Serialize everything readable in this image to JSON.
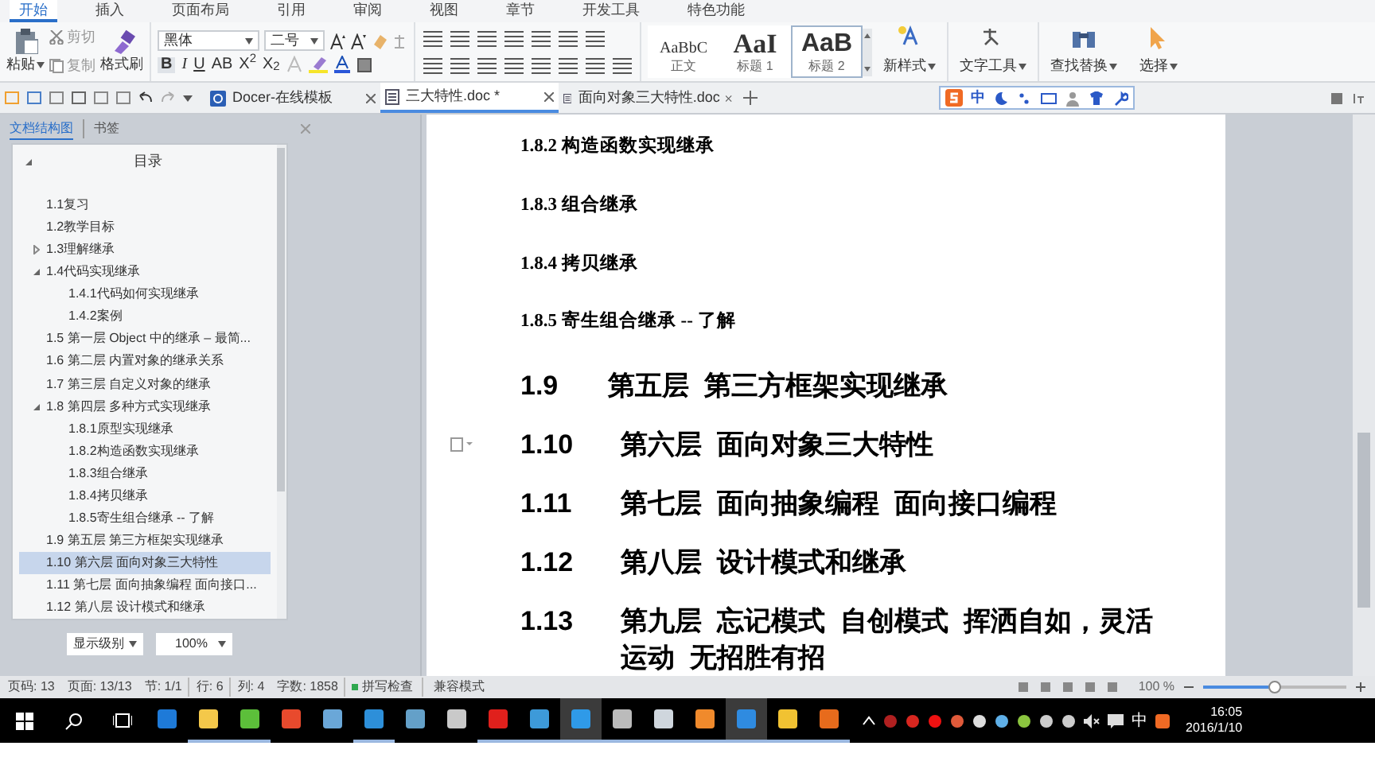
{
  "menu_tabs": [
    {
      "label": "开始",
      "selected": true
    },
    {
      "label": "插入",
      "selected": false
    },
    {
      "label": "页面布局",
      "selected": false
    },
    {
      "label": "引用",
      "selected": false
    },
    {
      "label": "审阅",
      "selected": false
    },
    {
      "label": "视图",
      "selected": false
    },
    {
      "label": "章节",
      "selected": false
    },
    {
      "label": "开发工具",
      "selected": false
    },
    {
      "label": "特色功能",
      "selected": false
    }
  ],
  "ribbon": {
    "paste": "粘贴",
    "cut": "剪切",
    "copy": "复制",
    "format_painter": "格式刷",
    "font_name": "黑体",
    "font_size": "二号",
    "format_buttons": [
      "B",
      "I",
      "U",
      "AB",
      "X$^{2}$",
      "X$_{2}$"
    ],
    "styles": [
      {
        "preview": "AaBbC",
        "label": "正文",
        "selected": false
      },
      {
        "preview": "AaI",
        "label": "标题 1",
        "selected": false
      },
      {
        "preview": "AaB",
        "label": "标题 2",
        "selected": true
      }
    ],
    "tools": [
      "新样式",
      "文字工具",
      "查找替换",
      "选择"
    ]
  },
  "doc_tabs": [
    {
      "label": "Docer-在线模板",
      "selected": false
    },
    {
      "label": "三大特性.doc *",
      "selected": true
    },
    {
      "label": "面向对象三大特性.doc",
      "selected": false
    }
  ],
  "ime_bar": {
    "mode": "中"
  },
  "navigation": {
    "tabs": [
      {
        "label": "文档结构图",
        "selected": true
      },
      {
        "label": "书签",
        "selected": false
      }
    ],
    "title": "目录",
    "items": [
      {
        "label": "1.1复习",
        "selected": false
      },
      {
        "label": "1.2教学目标",
        "selected": false
      },
      {
        "label": "1.3理解继承",
        "selected": false,
        "expanded": false
      },
      {
        "label": "1.4代码实现继承",
        "selected": false,
        "expanded": true,
        "children": [
          {
            "label": "1.4.1代码如何实现继承",
            "selected": false
          },
          {
            "label": "1.4.2案例",
            "selected": false
          }
        ]
      },
      {
        "label": "1.5 第一层 Object 中的继承 – 最简...",
        "selected": false
      },
      {
        "label": "1.6 第二层 内置对象的继承关系",
        "selected": false
      },
      {
        "label": "1.7 第三层 自定义对象的继承",
        "selected": false
      },
      {
        "label": "1.8 第四层 多种方式实现继承",
        "selected": false,
        "expanded": true,
        "children": [
          {
            "label": "1.8.1原型实现继承",
            "selected": false
          },
          {
            "label": "1.8.2构造函数实现继承",
            "selected": false
          },
          {
            "label": "1.8.3组合继承",
            "selected": false
          },
          {
            "label": "1.8.4拷贝继承",
            "selected": false
          },
          {
            "label": "1.8.5寄生组合继承 -- 了解",
            "selected": false
          }
        ]
      },
      {
        "label": "1.9 第五层 第三方框架实现继承",
        "selected": false
      },
      {
        "label": "1.10 第六层 面向对象三大特性",
        "selected": true
      },
      {
        "label": "1.11 第七层 面向抽象编程 面向接口...",
        "selected": false
      },
      {
        "label": "1.12 第八层 设计模式和继承",
        "selected": false
      }
    ],
    "level_select": "显示级别",
    "zoom_select": "100%"
  },
  "document": [
    {
      "kind": "sub",
      "text": "1.8.2 构造函数实现继承"
    },
    {
      "kind": "sub",
      "text": "1.8.3 组合继承"
    },
    {
      "kind": "sub",
      "text": "1.8.4 拷贝继承"
    },
    {
      "kind": "sub",
      "text": "1.8.5 寄生组合继承  --  了解"
    },
    {
      "kind": "main",
      "number": "1.9",
      "text": "第五层  第三方框架实现继承"
    },
    {
      "kind": "main",
      "number": "1.10",
      "text": "第六层  面向对象三大特性"
    },
    {
      "kind": "main",
      "number": "1.11",
      "text": "第七层  面向抽象编程  面向接口编程"
    },
    {
      "kind": "main",
      "number": "1.12",
      "text": "第八层  设计模式和继承"
    },
    {
      "kind": "main",
      "number": "1.13",
      "text": "第九层  忘记模式  自创模式  挥洒自如，灵活运动  无招胜有招"
    }
  ],
  "status_bar": {
    "items": [
      "页码: 13",
      "页面: 13/13",
      "节: 1/1",
      "行: 6",
      "列: 4",
      "字数: 1858"
    ],
    "spell_check": {
      "label": "拼写检查",
      "on": true
    },
    "mode": "兼容模式",
    "zoom": "100 %",
    "level": 0.5
  },
  "taskbar": {
    "apps": [
      {
        "running": false,
        "selected": false
      },
      {
        "running": true,
        "selected": false
      },
      {
        "running": true,
        "selected": false
      },
      {
        "running": false,
        "selected": false
      },
      {
        "running": false,
        "selected": false
      },
      {
        "running": true,
        "selected": false
      },
      {
        "running": false,
        "selected": false
      },
      {
        "running": false,
        "selected": false
      },
      {
        "running": true,
        "selected": false
      },
      {
        "running": true,
        "selected": false
      },
      {
        "running": true,
        "selected": true
      },
      {
        "running": true,
        "selected": false
      },
      {
        "running": true,
        "selected": false
      },
      {
        "running": true,
        "selected": false
      },
      {
        "running": true,
        "selected": true
      },
      {
        "running": true,
        "selected": false
      },
      {
        "running": true,
        "selected": false
      }
    ],
    "ime": "中",
    "time": "16:05",
    "date": "2016/1/10"
  }
}
